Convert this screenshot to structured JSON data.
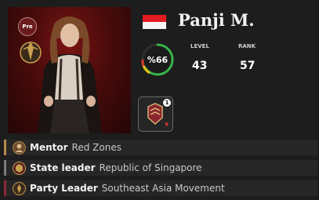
{
  "player": {
    "badge": "Pre",
    "name": "Panji M.",
    "activity_percent": "%66",
    "activity_fraction": 0.66
  },
  "stats": {
    "level_label": "LEVEL",
    "level_value": "43",
    "rank_label": "RANK",
    "rank_value": "57"
  },
  "medals": {
    "count": "1"
  },
  "roles": [
    {
      "title": "Mentor",
      "value": "Red Zones",
      "accent": "#b58a4a"
    },
    {
      "title": "State leader",
      "value": "Republic of Singapore",
      "accent": "#7a7a7a"
    },
    {
      "title": "Party Leader",
      "value": "Southeast Asia Movement",
      "accent": "#8b2a3a"
    }
  ],
  "colors": {
    "flag_red": "#e21b23",
    "ring_progress": "#37b34a",
    "ring_secondary": "#e5c11a"
  },
  "icons": {
    "emblem": "party-emblem-icon",
    "medal": "medal-icon"
  }
}
